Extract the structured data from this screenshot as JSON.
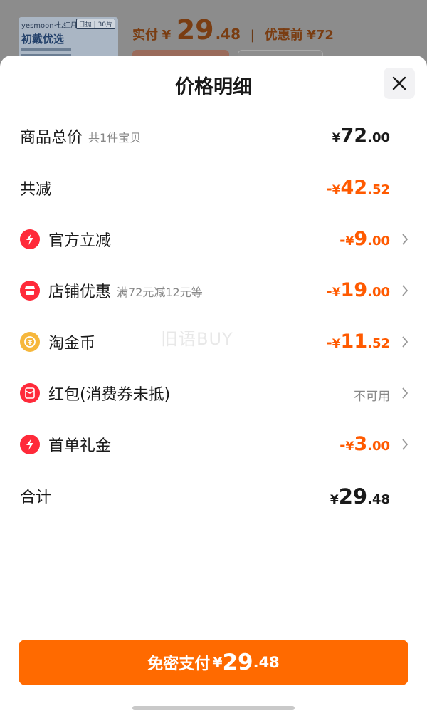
{
  "background": {
    "brand": "yesmoon·七红月",
    "badge": "日抛 | 30片",
    "product_title": "初戴优选",
    "actual_label": "实付",
    "actual_currency": "¥",
    "actual_int": "29",
    "actual_dec": ".48",
    "separator": "|",
    "before_label": "优惠前",
    "before_price": "¥72"
  },
  "sheet": {
    "title": "价格明细"
  },
  "rows": {
    "total": {
      "label": "商品总价",
      "sub": "共1件宝贝",
      "cur": "¥",
      "int": "72",
      "dec": ".00"
    },
    "reduce": {
      "label": "共减",
      "neg": "-",
      "cur": "¥",
      "int": "42",
      "dec": ".52"
    },
    "official": {
      "label": "官方立减",
      "neg": "-",
      "cur": "¥",
      "int": "9",
      "dec": ".00"
    },
    "store": {
      "label": "店铺优惠",
      "sub": "满72元减12元等",
      "neg": "-",
      "cur": "¥",
      "int": "19",
      "dec": ".00"
    },
    "coins": {
      "label": "淘金币",
      "neg": "-",
      "cur": "¥",
      "int": "11",
      "dec": ".52"
    },
    "redpacket": {
      "label": "红包(消费券未抵)",
      "status": "不可用"
    },
    "firstorder": {
      "label": "首单礼金",
      "neg": "-",
      "cur": "¥",
      "int": "3",
      "dec": ".00"
    },
    "sum": {
      "label": "合计",
      "cur": "¥",
      "int": "29",
      "dec": ".48"
    }
  },
  "pay_button": {
    "label": "免密支付",
    "cur": "¥",
    "int": "29",
    "dec": ".48"
  },
  "watermark": "旧语BUY",
  "colors": {
    "accent": "#ff5a00",
    "button": "#ff6a00",
    "icon_red": "#ff2a3a",
    "coin": "#f6b73c"
  }
}
